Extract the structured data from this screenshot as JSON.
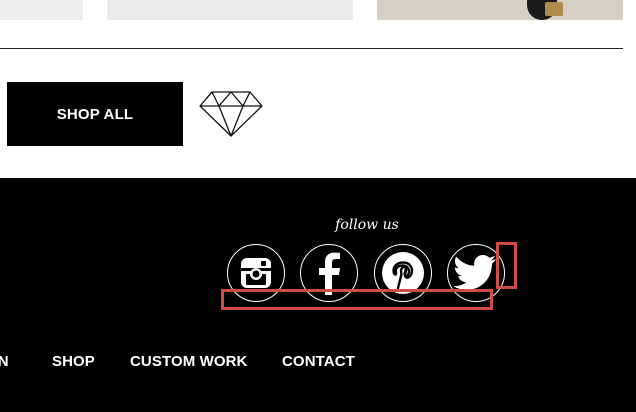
{
  "products": {
    "items": [
      {
        "name": "product-thumbnail-1"
      },
      {
        "name": "product-thumbnail-2"
      },
      {
        "name": "product-thumbnail-3"
      }
    ]
  },
  "cta": {
    "shop_all_label": "SHOP ALL",
    "diamond_icon": "diamond-icon"
  },
  "footer": {
    "follow_label": "follow us",
    "social": [
      {
        "icon": "instagram-icon"
      },
      {
        "icon": "facebook-icon"
      },
      {
        "icon": "pinterest-icon"
      },
      {
        "icon": "twitter-icon"
      }
    ],
    "nav": [
      "ON",
      "SHOP",
      "CUSTOM WORK",
      "CONTACT"
    ]
  },
  "colors": {
    "footer_bg": "#000000",
    "button_bg": "#000000",
    "text_on_dark": "#ffffff",
    "highlight": "#d24b44"
  }
}
